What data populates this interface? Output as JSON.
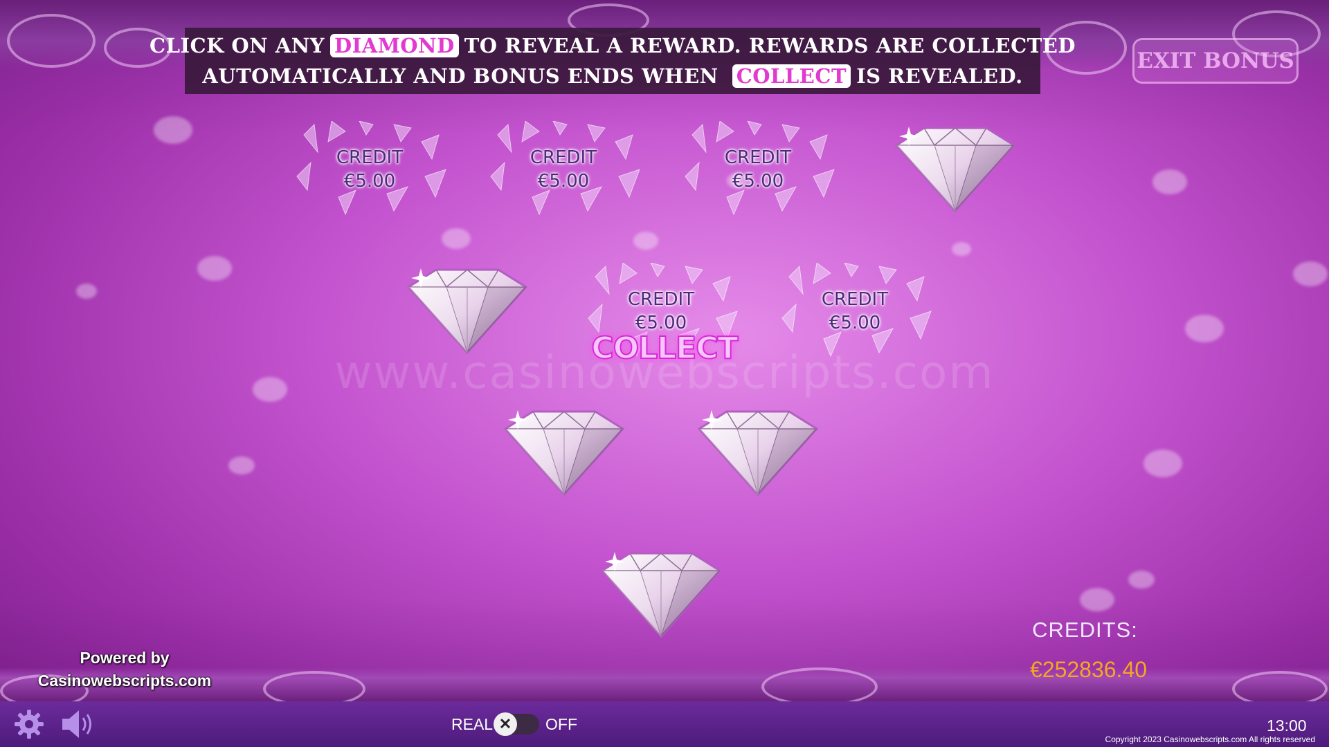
{
  "banner": {
    "line1_a": "CLICK ON ANY",
    "line1_hl": "DIAMOND",
    "line1_b": "TO REVEAL A REWARD. REWARDS ARE COLLECTED",
    "line2_a": "AUTOMATICALLY AND BONUS ENDS WHEN",
    "line2_hl": "COLLECT",
    "line2_b": "IS REVEALED."
  },
  "exit_button": {
    "label": "EXIT BONUS"
  },
  "tiles": [
    {
      "state": "revealed",
      "line1": "CREDIT",
      "line2": "€5.00"
    },
    {
      "state": "revealed",
      "line1": "CREDIT",
      "line2": "€5.00"
    },
    {
      "state": "revealed",
      "line1": "CREDIT",
      "line2": "€5.00"
    },
    {
      "state": "hidden"
    },
    {
      "state": "hidden"
    },
    {
      "state": "revealed",
      "line1": "CREDIT",
      "line2": "€5.00"
    },
    {
      "state": "revealed",
      "line1": "CREDIT",
      "line2": "€5.00"
    },
    {
      "state": "hidden"
    },
    {
      "state": "hidden"
    },
    {
      "state": "hidden"
    }
  ],
  "collect_text": "COLLECT",
  "watermark": "www.casinowebscripts.com",
  "powered_by": {
    "line1": "Powered by",
    "line2": "Casinowebscripts.com"
  },
  "credits": {
    "label": "CREDITS:",
    "value": "€252836.40"
  },
  "bottom_bar": {
    "mode_left": "REAL",
    "toggle_symbol": "✕",
    "mode_right": "OFF",
    "clock": "13:00",
    "copyright": "Copyright 2023 Casinowebscripts.com All rights reserved"
  },
  "colors": {
    "highlight_text": "#e23ad0",
    "credits_value": "#f5a723",
    "credit_label": "#4b2a7a",
    "bottom_bar": "#5a2289"
  },
  "icons": [
    "gear-icon",
    "speaker-icon",
    "diamond-icon",
    "toggle-x-icon"
  ]
}
